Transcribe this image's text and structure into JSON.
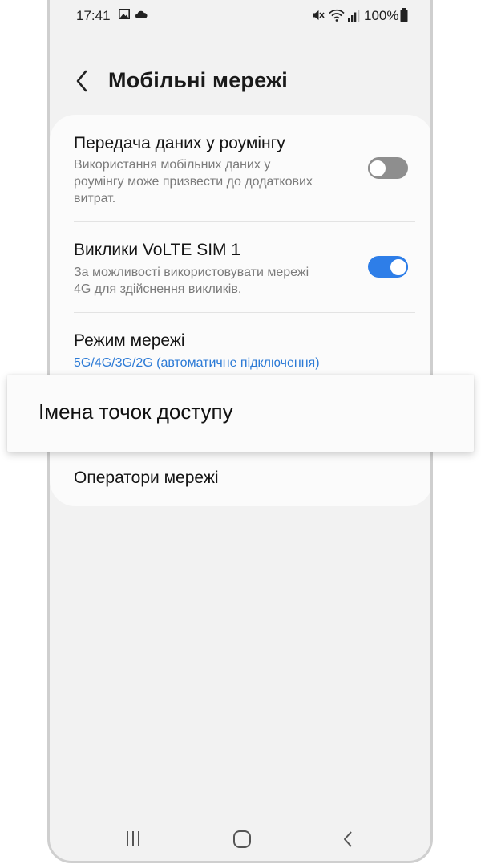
{
  "status_bar": {
    "time": "17:41",
    "battery_text": "100%",
    "icons": [
      "gallery-icon",
      "cloud-icon",
      "mute-icon",
      "wifi-icon",
      "signal-icon",
      "battery-icon"
    ]
  },
  "header": {
    "title": "Мобільні мережі",
    "back_icon": "chevron-left-icon"
  },
  "settings": {
    "roaming": {
      "title": "Передача даних у роумінгу",
      "subtitle_lines": [
        "Використання мобільних даних у",
        "роумінгу може призвести до додаткових",
        "витрат."
      ],
      "enabled": false
    },
    "volte": {
      "title": "Виклики VoLTE SIM 1",
      "subtitle_lines": [
        "За можливості використовувати мережі",
        "4G для здійснення викликів."
      ],
      "enabled": true
    },
    "network_mode": {
      "title": "Режим мережі",
      "value": "5G/4G/3G/2G (автоматичне підключення)"
    },
    "access_point_names": {
      "title": "Імена точок доступу"
    },
    "network_operators": {
      "title": "Оператори мережі"
    }
  },
  "nav_bar": {
    "icons": [
      "recents-icon",
      "home-icon",
      "back-icon"
    ]
  },
  "colors": {
    "accent": "#2e7ee8",
    "link": "#2b7ad6",
    "background": "#f2f2f2",
    "card": "#fbfbfb"
  }
}
